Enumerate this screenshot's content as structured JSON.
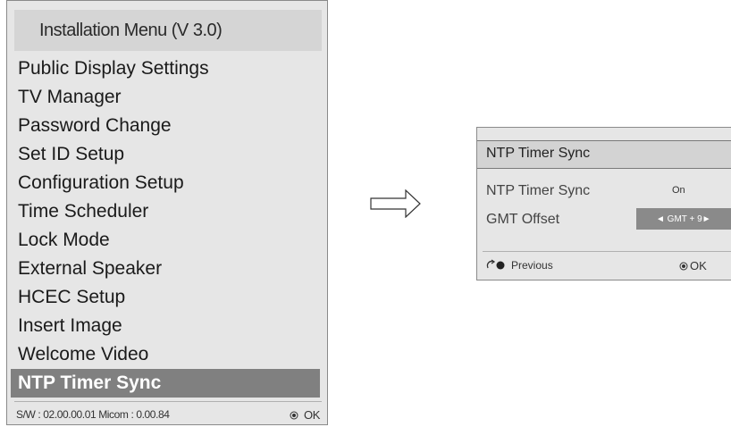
{
  "menu": {
    "title": "Installation Menu (V 3.0)",
    "items": [
      {
        "label": "Public Display Settings"
      },
      {
        "label": "TV Manager"
      },
      {
        "label": "Password Change"
      },
      {
        "label": "Set ID Setup"
      },
      {
        "label": "Configuration Setup"
      },
      {
        "label": "Time Scheduler"
      },
      {
        "label": "Lock Mode"
      },
      {
        "label": "External Speaker"
      },
      {
        "label": "HCEC Setup"
      },
      {
        "label": "Insert Image"
      },
      {
        "label": "Welcome Video"
      }
    ],
    "selected_item": "NTP Timer Sync",
    "footer_sw": "S/W : 02.00.00.01 Micom : 0.00.84",
    "footer_ok": "OK"
  },
  "ntp_panel": {
    "title": "NTP Timer Sync",
    "sync_label": "NTP Timer Sync",
    "sync_value": "On",
    "gmt_label": "GMT Offset",
    "gmt_value": "◄ GMT + 9►",
    "previous_label": "Previous",
    "ok_label": "OK"
  },
  "colors": {
    "panel_bg": "#e6e6e6",
    "header_bg": "#d5d5d5",
    "selected_bg": "#808080",
    "value_box_bg": "#8a8a8a"
  },
  "icons": {
    "ok": "radio-dot-icon",
    "previous": "back-return-icon",
    "arrow": "right-arrow-icon"
  }
}
